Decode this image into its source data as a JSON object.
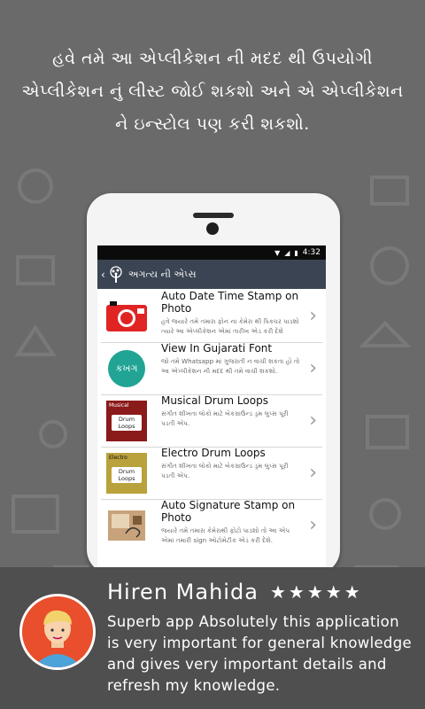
{
  "headline": "હવે તમે આ એપ્લીકેશન ની મદદ થી ઉપયોગી એપ્લીકેશન નું લીસ્ટ જોઈ શકશો અને એ એપ્લીકેશન ને ઇન્સ્ટોલ પણ કરી શકશો.",
  "status_bar": {
    "time": "4:32"
  },
  "app_bar": {
    "title": "અગત્ય ની એપ્સ"
  },
  "apps": [
    {
      "name": "Auto Date Time Stamp on Photo",
      "description": "હવે જયારે તમે તમારા ફોન ના કેમેરા થી પિક્ચર પાડશો ત્યારે આ એપ્લીકેશન એમાં તારીખ એડ કરી દેશે",
      "icon": "camera-icon"
    },
    {
      "name": "View In Gujarati Font",
      "description": "જો તમે Whatsapp માં ગુજરાતી ન વાચી શકતા હો તો આ એપ્લીકેશન ની મદદ થી તમે વાચી શકશો.",
      "icon": "gujarati-font-icon",
      "icon_text": "કખગ"
    },
    {
      "name": "Musical Drum Loops",
      "description": "સંગીત શીખતા લોકો માટે બેકગ્રાઉન્ડ ડ્રમ લુપ્સ પૂરી પડતી એપ.",
      "icon": "drum-loops-icon",
      "icon_label": "Musical",
      "icon_text": "Drum Loops"
    },
    {
      "name": "Electro Drum Loops",
      "description": "સંગીત શીખતા લોકો માટે બેકગ્રાઉન્ડ ડ્રમ લુપ્સ પૂરી પડતી એપ.",
      "icon": "drum-loops-icon",
      "icon_label": "Electro",
      "icon_text": "Drum Loops"
    },
    {
      "name": "Auto Signature Stamp on Photo",
      "description": "જયારે તમે તમારા કેમેરાથી ફોટો પાડશો તો આ એપ એમાં તમારી sign ઓટોમેટીક એડ કરી દેશે.",
      "icon": "signature-photo-icon"
    }
  ],
  "review": {
    "name": "Hiren Mahida",
    "stars": "★★★★★",
    "text": "Superb app Absolutely this application is very important for general knowledge and  gives very important details and refresh my knowledge."
  }
}
